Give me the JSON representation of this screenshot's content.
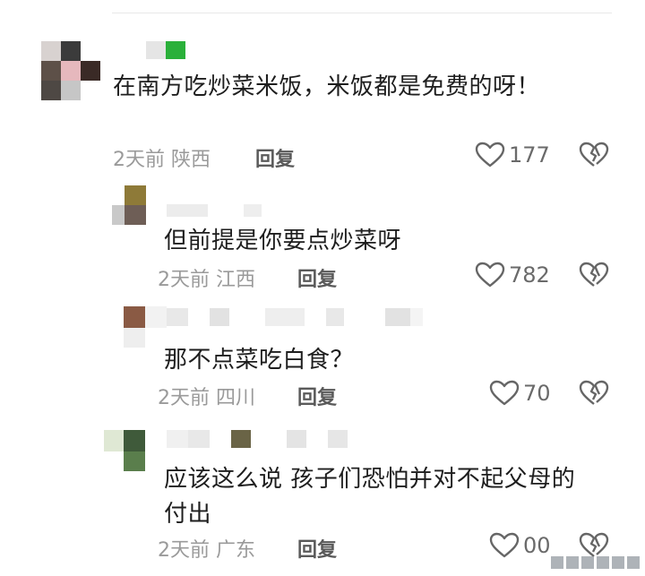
{
  "comments": [
    {
      "text": "在南方吃炒菜米饭，米饭都是免费的呀！",
      "date": "2天前",
      "location": "陕西",
      "reply_label": "回复",
      "likes": "177"
    },
    {
      "text": "但前提是你要点炒菜呀",
      "date": "2天前",
      "location": "江西",
      "reply_label": "回复",
      "likes": "782"
    },
    {
      "text": "那不点菜吃白食？",
      "date": "2天前",
      "location": "四川",
      "reply_label": "回复",
      "likes": "70"
    },
    {
      "text": "应该这么说 孩子们恐怕并对不起父母的付出",
      "date": "2天前",
      "location": "广东",
      "reply_label": "回复",
      "likes": "00"
    }
  ],
  "icons": {
    "like": "heart-outline-icon",
    "dislike": "broken-heart-icon"
  },
  "colors": {
    "meta": "#9a9a9a",
    "text": "#1e1e1e",
    "reply": "#5a5a5a"
  }
}
